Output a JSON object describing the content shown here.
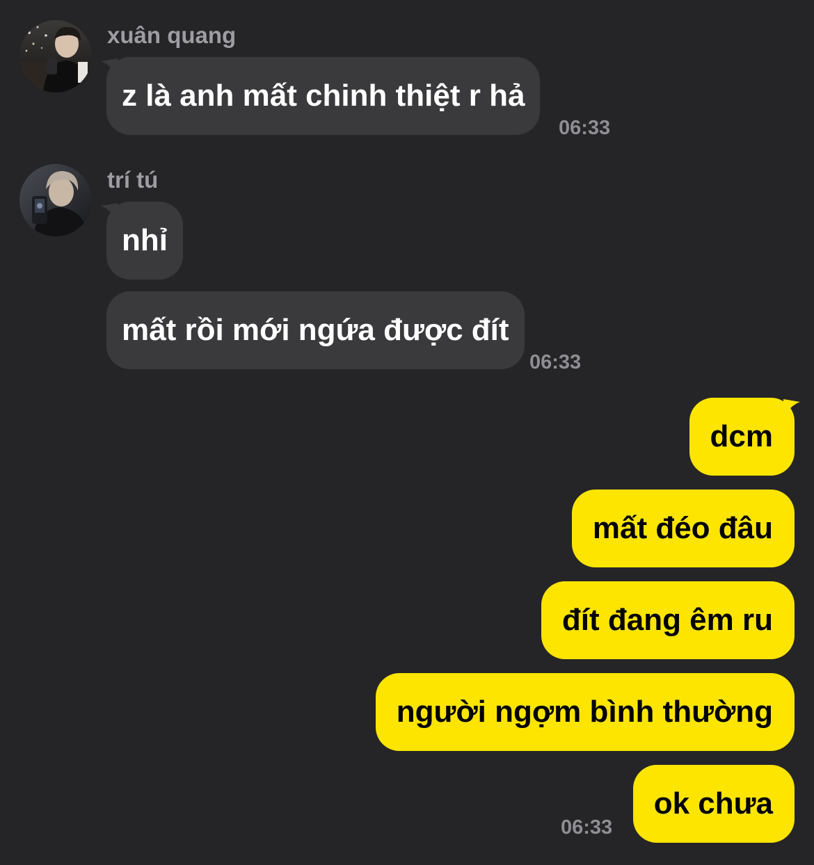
{
  "colors": {
    "background": "#252527",
    "incoming_bubble": "#3a3a3c",
    "outgoing_bubble": "#fee500",
    "sender_name": "#9d9da2",
    "timestamp": "#8e8e93"
  },
  "groups": [
    {
      "sender": "xuân quang",
      "avatar": "profile-photo",
      "messages": [
        "z là anh mất chinh thiệt r hả"
      ],
      "time": "06:33"
    },
    {
      "sender": "trí tú",
      "avatar": "profile-photo",
      "messages": [
        "nhỉ",
        "mất rồi mới ngứa được đít"
      ],
      "time": "06:33"
    }
  ],
  "outgoing": {
    "messages": [
      "dcm",
      "mất đéo đâu",
      "đít đang êm ru",
      "người ngợm bình thường",
      "ok chưa"
    ],
    "time": "06:33"
  }
}
